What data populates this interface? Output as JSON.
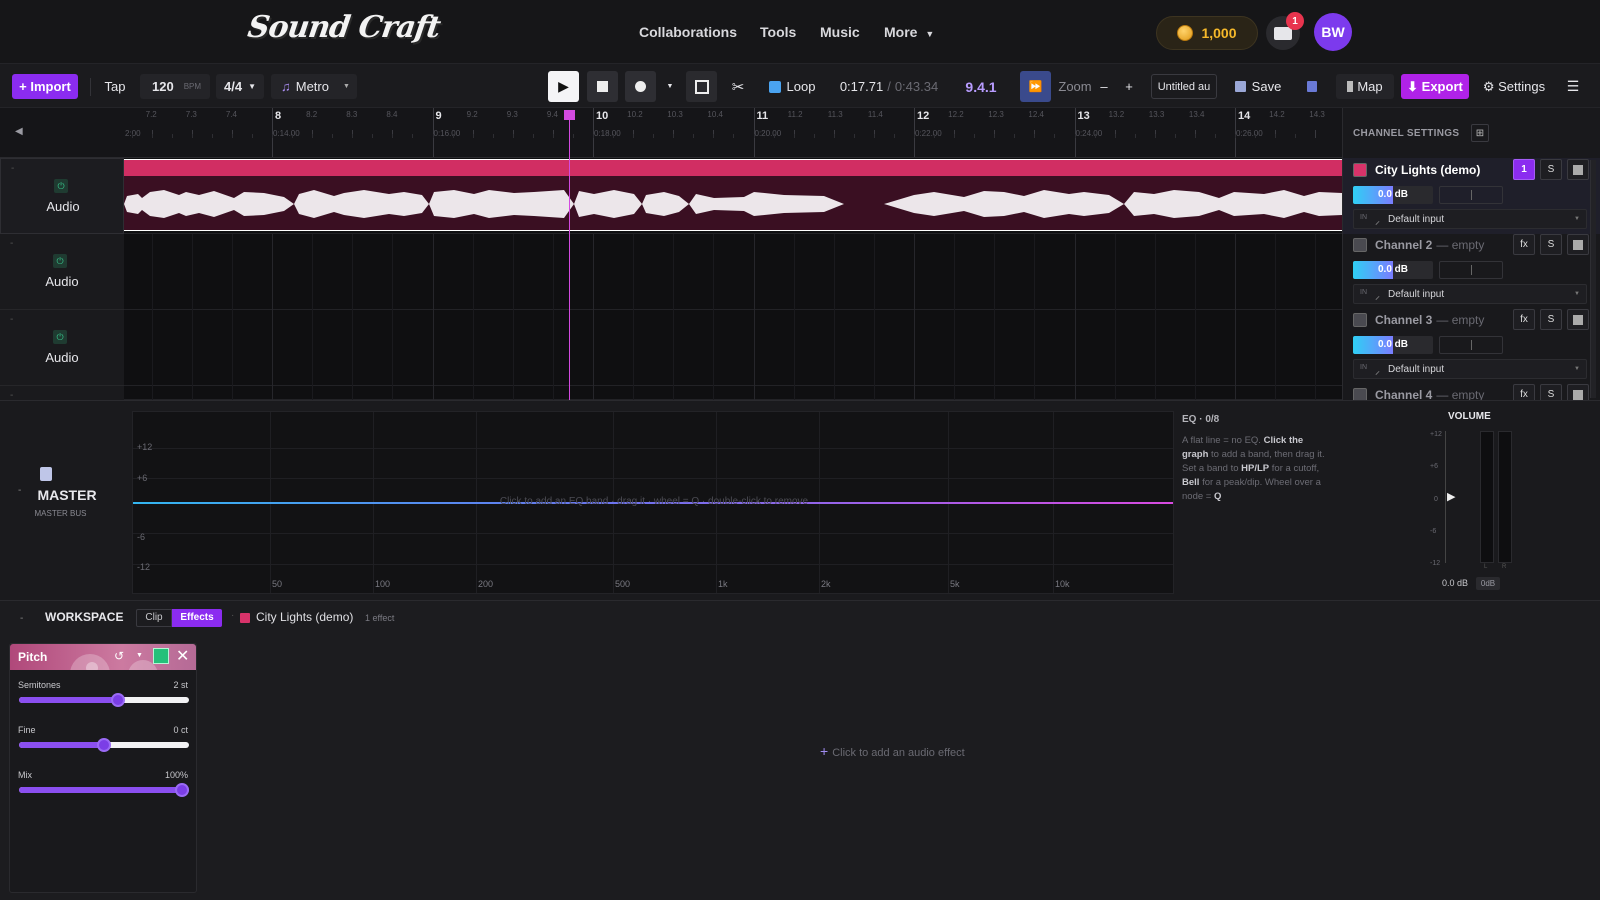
{
  "brand": {
    "logo_text": "Sound Craft"
  },
  "nav": {
    "items": [
      "Collaborations",
      "Tools",
      "Music",
      "More"
    ]
  },
  "user": {
    "coins": "1,000",
    "inbox_count": "1",
    "initials": "BW"
  },
  "toolbar": {
    "import_label": "+ Import",
    "tap_label": "Tap",
    "bpm_value": "120",
    "bpm_unit": "BPM",
    "time_signature": "4/4",
    "metro_label": "Metro",
    "loop_label": "Loop",
    "time_current": "0:17.71",
    "time_separator": "/",
    "time_total": "0:43.34",
    "position": "9.4.1",
    "zoom_label": "Zoom",
    "zoom_out": "–",
    "zoom_in": "+",
    "project_name": "Untitled au",
    "save_label": "Save",
    "map_label": "Map",
    "export_label": "⬇ Export",
    "settings_label": "⚙ Settings",
    "accent_color": "#8b2cf0"
  },
  "ruler": {
    "bars": [
      "8",
      "9",
      "10",
      "11",
      "12",
      "13",
      "14"
    ],
    "times": [
      "2:00",
      "0:14.00",
      "0:16.00",
      "0:18.00",
      "0:20.00",
      "0:22.00",
      "0:24.00",
      "0:26.00"
    ],
    "subs": [
      [
        "7.2",
        "7.3",
        "7.4"
      ],
      [
        "8.2",
        "8.3",
        "8.4"
      ],
      [
        "9.2",
        "9.3",
        "9.4"
      ],
      [
        "10.2",
        "10.3",
        "10.4"
      ],
      [
        "11.2",
        "11.3",
        "11.4"
      ],
      [
        "12.2",
        "12.3",
        "12.4"
      ],
      [
        "13.2",
        "13.3",
        "13.4"
      ],
      [
        "14.2",
        "14.3"
      ]
    ],
    "collapse_glyph": "◀"
  },
  "tracks": [
    {
      "name": "Audio"
    },
    {
      "name": "Audio"
    },
    {
      "name": "Audio"
    }
  ],
  "channel_settings": {
    "title": "CHANNEL SETTINGS",
    "channels": [
      {
        "name": "City Lights (demo)",
        "suffix": "",
        "color": "#d8336a",
        "fx_label": "1",
        "solo_label": "S",
        "volume": "0.0 dB",
        "input_prefix": "IN",
        "input": "Default input",
        "active": true
      },
      {
        "name": "Channel 2",
        "suffix": "— empty",
        "color": "#4a4a50",
        "fx_label": "fx",
        "solo_label": "S",
        "volume": "0.0 dB",
        "input_prefix": "IN",
        "input": "Default input",
        "active": false
      },
      {
        "name": "Channel 3",
        "suffix": "— empty",
        "color": "#4a4a50",
        "fx_label": "fx",
        "solo_label": "S",
        "volume": "0.0 dB",
        "input_prefix": "IN",
        "input": "Default input",
        "active": false
      },
      {
        "name": "Channel 4",
        "suffix": "— empty",
        "color": "#4a4a50",
        "fx_label": "fx",
        "solo_label": "S",
        "volume": "",
        "input_prefix": "",
        "input": "",
        "active": false
      }
    ]
  },
  "master": {
    "title": "MASTER",
    "subtitle": "MASTER BUS",
    "eq_title": "EQ · 0/8",
    "eq_hint": "Click to add an EQ band · drag it · wheel = Q · double-click to remove",
    "eq_help_1": "A flat line = no EQ. ",
    "eq_help_2": "Click the graph",
    "eq_help_3": " to add a band, then drag it. Set a band to ",
    "eq_help_4": "HP/LP",
    "eq_help_5": " for a cutoff, ",
    "eq_help_6": "Bell",
    "eq_help_7": " for a peak/dip. Wheel over a node = ",
    "eq_help_8": "Q",
    "db_labels": [
      "+12",
      "+6",
      "-6",
      "-12"
    ],
    "freq_labels": [
      "50",
      "100",
      "200",
      "500",
      "1k",
      "2k",
      "5k",
      "10k"
    ],
    "volume_title": "VOLUME",
    "volume_ticks": [
      "+12",
      "+6",
      "0",
      "-6",
      "-12"
    ],
    "meter_labels": [
      "L",
      "R"
    ],
    "volume_value": "0.0 dB",
    "volume_tag": "0dB"
  },
  "workspace": {
    "title": "WORKSPACE",
    "tabs": [
      "Clip",
      "Effects"
    ],
    "active_tab": "Effects",
    "clip_name": "City Lights (demo)",
    "effect_count": "1 effect",
    "add_hint": "Click to add an audio effect",
    "effect": {
      "name": "Pitch",
      "params": [
        {
          "label": "Semitones",
          "value": "2 st",
          "level": 0.58
        },
        {
          "label": "Fine",
          "value": "0 ct",
          "level": 0.5
        },
        {
          "label": "Mix",
          "value": "100%",
          "level": 1.0
        }
      ]
    }
  }
}
